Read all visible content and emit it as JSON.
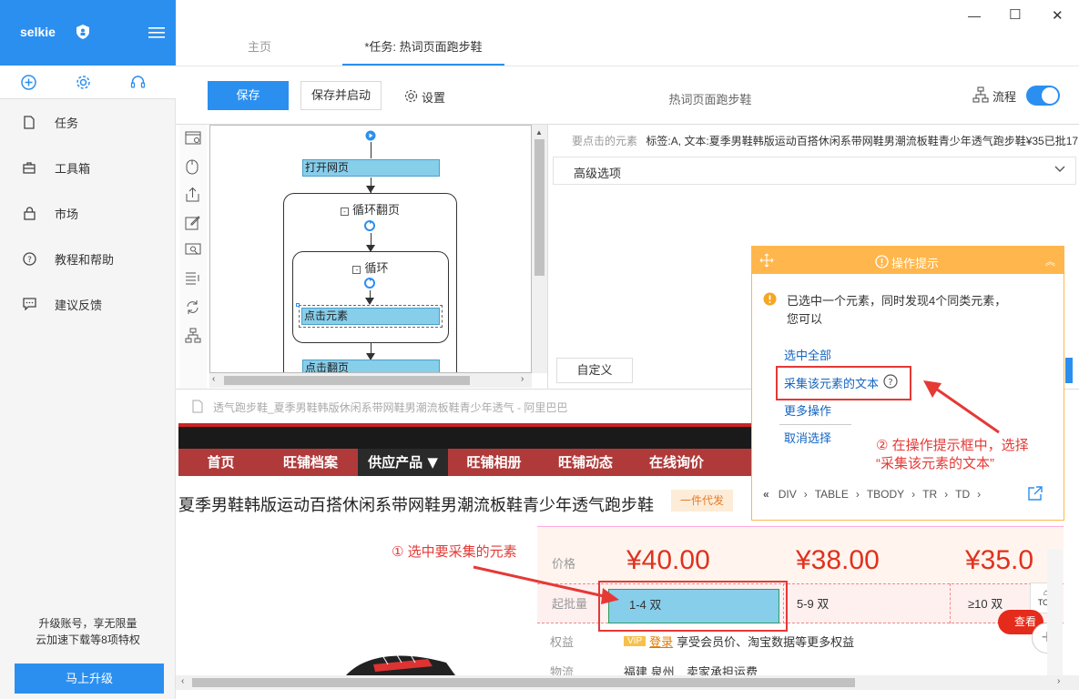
{
  "app": {
    "name": "selkie"
  },
  "window": {
    "minimize": "—",
    "maximize": "☐",
    "close": "✕"
  },
  "sidebar": {
    "items": [
      {
        "label": "任务",
        "icon": "document-icon"
      },
      {
        "label": "工具箱",
        "icon": "toolbox-icon"
      },
      {
        "label": "市场",
        "icon": "bag-icon"
      },
      {
        "label": "教程和帮助",
        "icon": "help-icon"
      },
      {
        "label": "建议反馈",
        "icon": "feedback-icon"
      }
    ],
    "promo_line1": "升级账号，享无限量",
    "promo_line2": "云加速下载等8项特权",
    "upgrade_label": "马上升级"
  },
  "tabs": [
    {
      "label": "主页",
      "active": false
    },
    {
      "label": "*任务: 热词页面跑步鞋",
      "active": true
    }
  ],
  "toolbar": {
    "save": "保存",
    "save_start": "保存并启动",
    "settings": "设置",
    "task_title": "热词页面跑步鞋",
    "flow_label": "流程"
  },
  "flow": {
    "open_page": "打开网页",
    "loop_page": "循环翻页",
    "loop": "循环",
    "click_element": "点击元素",
    "click_page": "点击翻页"
  },
  "props": {
    "element_label": "要点击的元素",
    "element_value": "标签:A, 文本:夏季男鞋韩版运动百搭休闲系带网鞋男潮流板鞋青少年透气跑步鞋¥35已批17",
    "advanced": "高级选项",
    "custom": "自定义"
  },
  "tips": {
    "title": "操作提示",
    "message_line1": "已选中一个元素，同时发现4个同类元素，",
    "message_line2": "您可以",
    "select_all": "选中全部",
    "collect_text": "采集该元素的文本",
    "more_ops": "更多操作",
    "cancel": "取消选择",
    "breadcrumb": [
      "DIV",
      "TABLE",
      "TBODY",
      "TR",
      "TD"
    ]
  },
  "annotations": {
    "step1": "① 选中要采集的元素",
    "step2_line1": "② 在操作提示框中，选择",
    "step2_line2": "“采集该元素的文本”"
  },
  "browser": {
    "url": "透气跑步鞋_夏季男鞋韩版休闲系带网鞋男潮流板鞋青少年透气 - 阿里巴巴"
  },
  "shop": {
    "nav": [
      "首页",
      "旺铺档案",
      "供应产品 ▼",
      "旺铺相册",
      "旺铺动态",
      "在线询价"
    ],
    "product_title": "夏季男鞋韩版运动百搭休闲系带网鞋男潮流板鞋青少年透气跑步鞋",
    "tag": "一件代发",
    "price_label": "价格",
    "prices": [
      "¥40.00",
      "¥38.00",
      "¥35.0"
    ],
    "moq_label": "起批量",
    "moqs": [
      "1-4 双",
      "5-9 双",
      "≥10 双"
    ],
    "rights_label": "权益",
    "vip": "VIP",
    "login": "登录",
    "rights_text": "享受会员价、淘宝数据等更多权益",
    "logistics_label": "物流",
    "logistics_place": "福建 泉州",
    "logistics_fee": "卖家承担运费",
    "top_btn": "TOP",
    "view_btn": "查看"
  },
  "colors": {
    "primary": "#2b8ff0",
    "warning": "#ffb74d",
    "annotation": "#e53935",
    "shop_red": "#b03a3a"
  }
}
